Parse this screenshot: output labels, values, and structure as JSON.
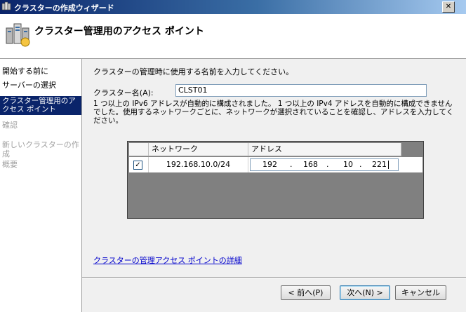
{
  "window": {
    "title": "クラスターの作成ウィザード",
    "close_label": "✕"
  },
  "header": {
    "title": "クラスター管理用のアクセス ポイント"
  },
  "sidebar": {
    "items": [
      {
        "label": "開始する前に",
        "state": "normal"
      },
      {
        "label": "サーバーの選択",
        "state": "normal"
      },
      {
        "label": "クラスター管理用のアクセス ポイント",
        "state": "active"
      },
      {
        "label": "確認",
        "state": "disabled"
      },
      {
        "label": "新しいクラスターの作成",
        "state": "disabled"
      },
      {
        "label": "概要",
        "state": "disabled"
      }
    ]
  },
  "content": {
    "instruction": "クラスターの管理時に使用する名前を入力してください。",
    "cluster_name_label": "クラスター名(A):",
    "cluster_name_value": "CLST01",
    "note": "1 つ以上の IPv6 アドレスが自動的に構成されました。 1 つ以上の IPv4 アドレスを自動的に構成できませんでした。使用するネットワークごとに、ネットワークが選択されていることを確認し、アドレスを入力してください。",
    "table": {
      "headers": [
        "ネットワーク",
        "アドレス"
      ],
      "rows": [
        {
          "checked": true,
          "checkmark": "✓",
          "network": "192.168.10.0/24",
          "address": [
            "192",
            "168",
            "10",
            "221"
          ]
        }
      ]
    },
    "help_link": "クラスターの管理アクセス ポイントの詳細"
  },
  "buttons": {
    "back": "< 前へ(P)",
    "next": "次へ(N) >",
    "cancel": "キャンセル"
  },
  "colors": {
    "selection": "#0a246a",
    "link": "#0000cc"
  }
}
